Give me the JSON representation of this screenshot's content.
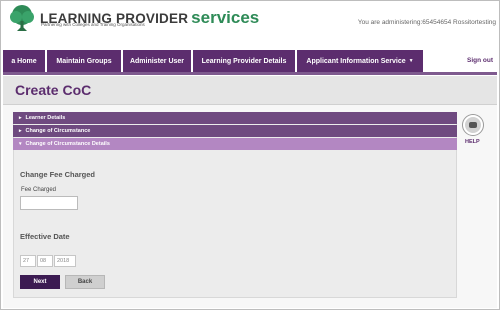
{
  "header": {
    "brand_main": "LEARNING PROVIDER",
    "brand_accent": "services",
    "tagline": "Partnering with Colleges and Training Organisations",
    "admin_text": "You are administering:65454654 Rossitortesting"
  },
  "nav": {
    "items": [
      {
        "label": "a Home"
      },
      {
        "label": "Maintain Groups"
      },
      {
        "label": "Administer User"
      },
      {
        "label": "Learning Provider Details"
      },
      {
        "label": "Applicant Information Service",
        "caret": "▼"
      }
    ],
    "signout": "Sign out"
  },
  "page": {
    "title": "Create CoC"
  },
  "accordion": [
    {
      "label": "Learner Details",
      "arrow": "▸"
    },
    {
      "label": "Change of Circumstance",
      "arrow": "▸"
    },
    {
      "label": "Change of Circumstance Details",
      "arrow": "▾"
    }
  ],
  "form": {
    "fee_section": "Change Fee Charged",
    "fee_label": "Fee Charged",
    "fee_value": "",
    "date_section": "Effective Date",
    "date_day": "27",
    "date_month": "08",
    "date_year": "2018",
    "next_label": "Next",
    "back_label": "Back"
  },
  "help": {
    "label": "HELP"
  },
  "colors": {
    "brand_purple": "#5c2d6e",
    "accent_green": "#2e8b57",
    "accordion_active": "#b387c2"
  }
}
